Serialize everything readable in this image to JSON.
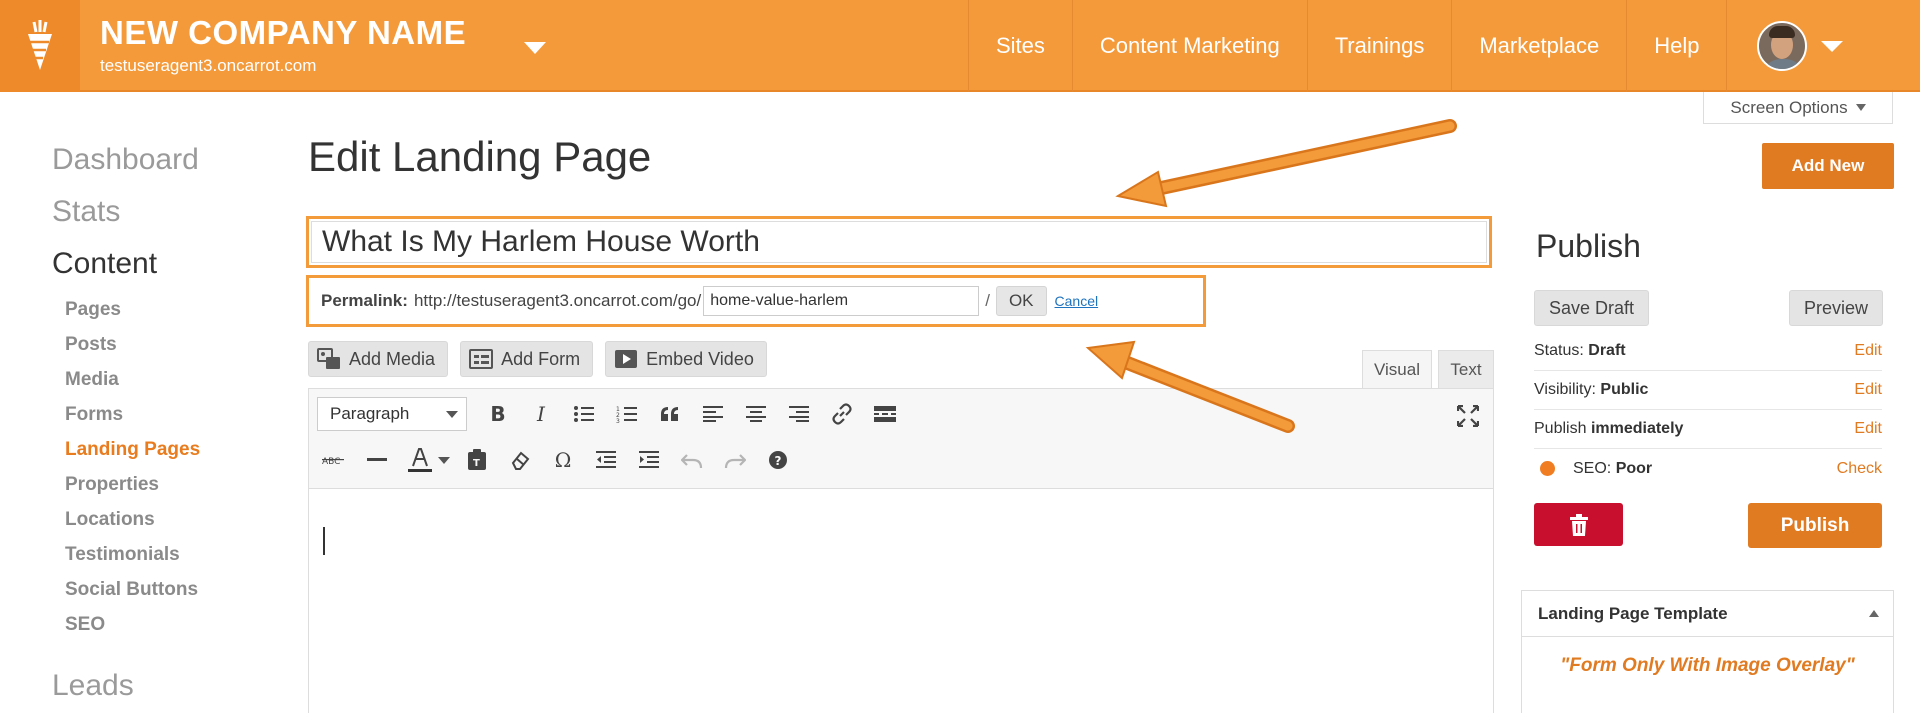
{
  "header": {
    "company_name": "NEW COMPANY NAME",
    "site_url": "testuseragent3.oncarrot.com",
    "nav": [
      "Sites",
      "Content Marketing",
      "Trainings",
      "Marketplace",
      "Help"
    ]
  },
  "sidebar": {
    "dashboard": "Dashboard",
    "stats": "Stats",
    "content": "Content",
    "items": [
      "Pages",
      "Posts",
      "Media",
      "Forms",
      "Landing Pages",
      "Properties",
      "Locations",
      "Testimonials",
      "Social Buttons",
      "SEO"
    ],
    "active_item": "Landing Pages",
    "leads": "Leads"
  },
  "main": {
    "page_title": "Edit Landing Page",
    "post_title": "What Is My Harlem House Worth",
    "permalink_label": "Permalink:",
    "permalink_base": "http://testuseragent3.oncarrot.com/go/",
    "slug": "home-value-harlem",
    "slash": "/",
    "ok_label": "OK",
    "cancel_label": "Cancel",
    "media_buttons": [
      "Add Media",
      "Add Form",
      "Embed Video"
    ],
    "tabs": {
      "visual": "Visual",
      "text": "Text"
    },
    "format_select": "Paragraph"
  },
  "right": {
    "screen_options": "Screen Options",
    "add_new": "Add New",
    "publish_title": "Publish",
    "save_draft": "Save Draft",
    "preview": "Preview",
    "status_label": "Status:",
    "status_value": "Draft",
    "visibility_label": "Visibility:",
    "visibility_value": "Public",
    "publish_label": "Publish",
    "publish_value": "immediately",
    "seo_label": "SEO:",
    "seo_value": "Poor",
    "edit": "Edit",
    "check": "Check",
    "publish_button": "Publish",
    "template_heading": "Landing Page Template",
    "template_name": "\"Form Only With Image Overlay\""
  },
  "colors": {
    "header": "#f49a3b",
    "accent": "#e07b22",
    "danger": "#c8102e",
    "highlight_border": "#f39a3a"
  }
}
